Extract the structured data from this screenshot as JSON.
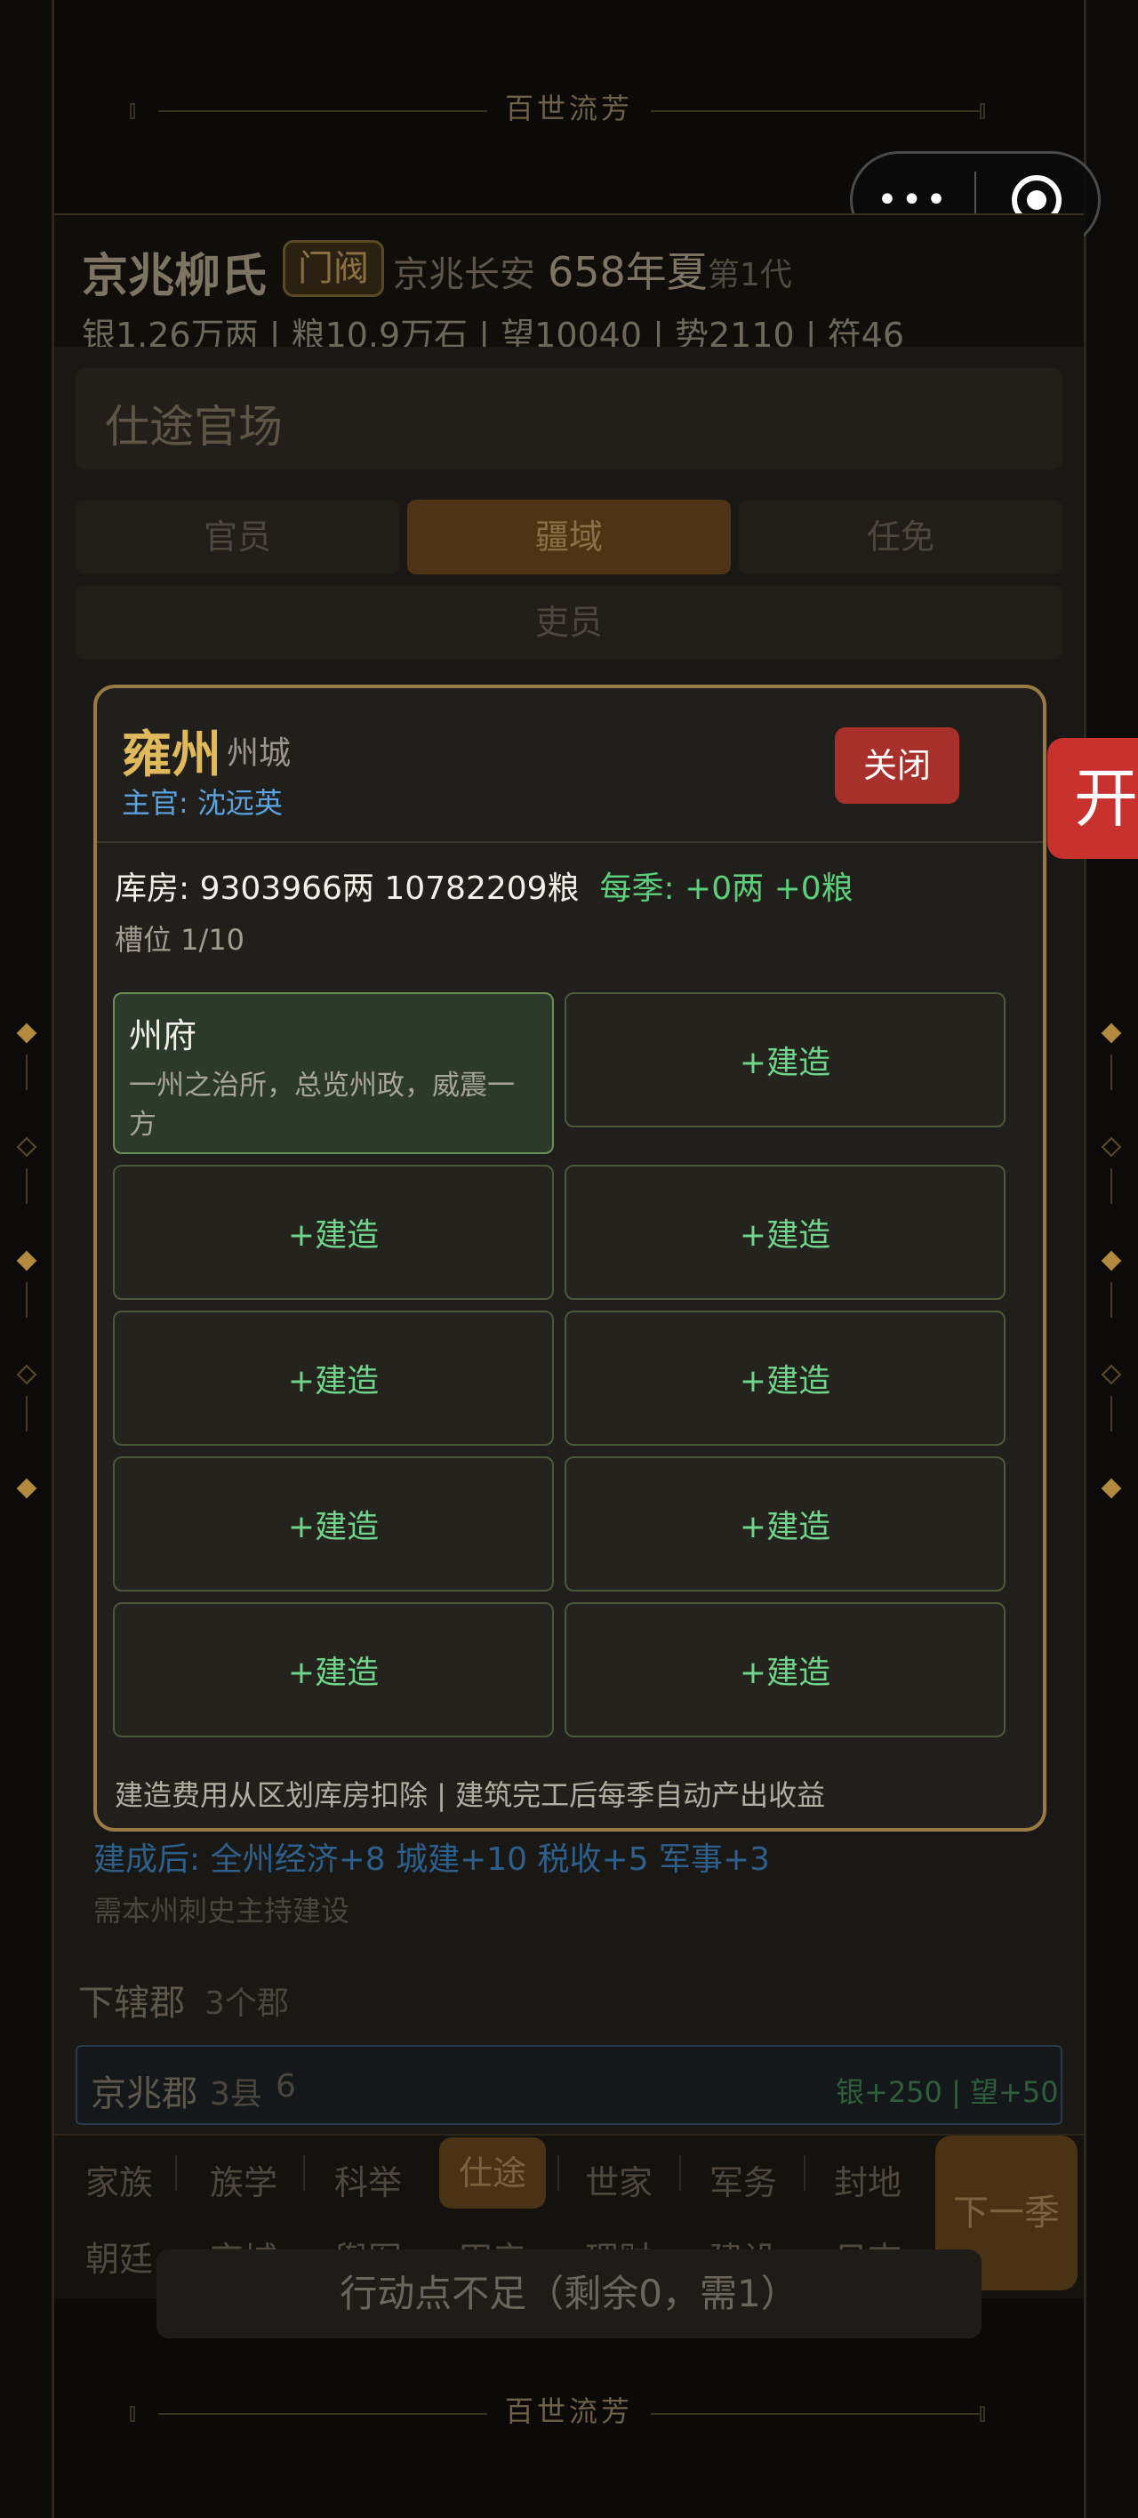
{
  "banner": {
    "title": "百世流芳"
  },
  "capsule": {
    "more_icon": "•••"
  },
  "clan": {
    "name": "京兆柳氏",
    "rank_badge": "门阀",
    "location": "京兆长安",
    "year": "658年夏",
    "generation": "第1代",
    "stats": "银1.26万两 | 粮10.9万石 | 望10040 | 势2110 | 符46"
  },
  "section": {
    "title": "仕途官场",
    "tabs": [
      "官员",
      "疆域",
      "任免",
      "吏员"
    ],
    "active_tab": "疆域"
  },
  "background_info": {
    "after_build": "建成后: 全州经济+8 城建+10 税收+5 军事+3",
    "requirement": "需本州刺史主持建设",
    "sub_header": "下辖郡",
    "sub_count": "3个郡",
    "commandery_name": "京兆郡",
    "commandery_count": "3县",
    "commandery_extra": "6",
    "commandery_income": "银+250 | 望+50"
  },
  "nav": {
    "row1": [
      "家族",
      "族学",
      "科举",
      "仕途",
      "世家",
      "军务",
      "封地"
    ],
    "row2": [
      "朝廷",
      "京城",
      "舆图",
      "田产",
      "理财",
      "建设",
      "日志"
    ],
    "active": "仕途",
    "next_button": "下一季"
  },
  "toast": "行动点不足（剩余0，需1）",
  "side_tab": "开",
  "modal": {
    "title": "雍州",
    "type": "州城",
    "official": "主官: 沈远英",
    "close_label": "关闭",
    "treasury_prefix": "库房: 9303966两 10782209粮",
    "treasury_season": "每季: +0两 +0粮",
    "slots": "槽位 1/10",
    "built": {
      "name": "州府",
      "desc": "一州之治所，总览州政，威震一方"
    },
    "build_label": "+建造",
    "footer": "建造费用从区划库房扣除 | 建筑完工后每季自动产出收益"
  },
  "colors": {
    "accent_gold": "#e1b95d",
    "close_red": "#a8302a",
    "build_green": "#6fd58a",
    "official_blue": "#5aa2e0"
  }
}
